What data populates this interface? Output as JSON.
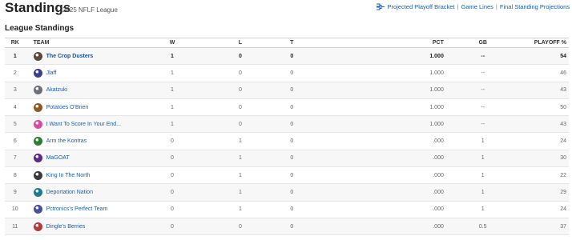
{
  "header": {
    "title": "Standings",
    "subtitle": "2025 NFLF League",
    "links": [
      {
        "label": "Projected Playoff Bracket",
        "icon": "bracket-icon"
      },
      {
        "label": "Game Lines"
      },
      {
        "label": "Final Standing Projections"
      }
    ]
  },
  "section_title": "League Standings",
  "columns": {
    "rk": "RK",
    "team": "TEAM",
    "w": "W",
    "l": "L",
    "t": "T",
    "pct": "PCT",
    "gb": "GB",
    "playoff": "PLAYOFF %"
  },
  "rows": [
    {
      "rk": "1",
      "team": "The Crop Dusters",
      "w": "1",
      "l": "0",
      "t": "0",
      "pct": "1.000",
      "gb": "--",
      "playoff": "54",
      "logo_color": "#5a4a3a"
    },
    {
      "rk": "2",
      "team": "Jlaff",
      "w": "1",
      "l": "0",
      "t": "0",
      "pct": "1.000",
      "gb": "--",
      "playoff": "46",
      "logo_color": "#3b3e8a"
    },
    {
      "rk": "3",
      "team": "Akatzuki",
      "w": "1",
      "l": "0",
      "t": "0",
      "pct": "1.000",
      "gb": "--",
      "playoff": "43",
      "logo_color": "#6a6f7a"
    },
    {
      "rk": "4",
      "team": "Potatoes O'Brien",
      "w": "1",
      "l": "0",
      "t": "0",
      "pct": "1.000",
      "gb": "--",
      "playoff": "50",
      "logo_color": "#8a5a2a"
    },
    {
      "rk": "5",
      "team": "I Want To Score In Your End...",
      "w": "1",
      "l": "0",
      "t": "0",
      "pct": "1.000",
      "gb": "--",
      "playoff": "43",
      "logo_color": "#d94aa0"
    },
    {
      "rk": "6",
      "team": "Arm the Kontras",
      "w": "0",
      "l": "1",
      "t": "0",
      "pct": ".000",
      "gb": "1",
      "playoff": "24",
      "logo_color": "#2e7d32"
    },
    {
      "rk": "7",
      "team": "MaGOAT",
      "w": "0",
      "l": "1",
      "t": "0",
      "pct": ".000",
      "gb": "1",
      "playoff": "30",
      "logo_color": "#5b2a86"
    },
    {
      "rk": "8",
      "team": "King In The North",
      "w": "0",
      "l": "1",
      "t": "0",
      "pct": ".000",
      "gb": "1",
      "playoff": "22",
      "logo_color": "#3a3a3a"
    },
    {
      "rk": "9",
      "team": "Deportation Nation",
      "w": "0",
      "l": "1",
      "t": "0",
      "pct": ".000",
      "gb": "1",
      "playoff": "29",
      "logo_color": "#1f7a8c"
    },
    {
      "rk": "10",
      "team": "Pctronics's Perfect Team",
      "w": "0",
      "l": "1",
      "t": "0",
      "pct": ".000",
      "gb": "1",
      "playoff": "24",
      "logo_color": "#4a4f9a"
    },
    {
      "rk": "11",
      "team": "Dingle's Berries",
      "w": "0",
      "l": "0",
      "t": "0",
      "pct": ".000",
      "gb": "0.5",
      "playoff": "37",
      "logo_color": "#b23a3a"
    }
  ]
}
